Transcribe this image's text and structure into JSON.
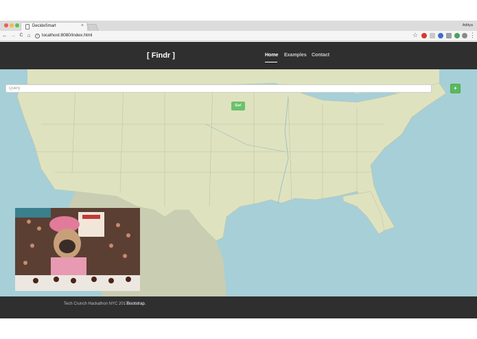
{
  "browser": {
    "tab_title": "DecideSmart",
    "tab_close": "×",
    "url": "localhost:8080/index.html",
    "user_name": "Aditya",
    "back": "←",
    "forward": "→",
    "reload": "C",
    "home": "⌂",
    "info": "i",
    "star": "☆",
    "menu": "⋮"
  },
  "header": {
    "brand": "[ Findr ]",
    "nav": [
      {
        "label": "Home",
        "active": true
      },
      {
        "label": "Examples",
        "active": false
      },
      {
        "label": "Contact",
        "active": false
      }
    ]
  },
  "search": {
    "placeholder": "Query",
    "value": "",
    "add_label": "+",
    "go_label": "Go!"
  },
  "map": {
    "water_color": "#a6cfd8",
    "land_color": "#dfe2bf",
    "gulf_land_color": "#c9cdb1"
  },
  "footer": {
    "text": "Tech Crunch Hackathon NYC 2017",
    "link": "Bootstrap",
    "suffix": "."
  },
  "colors": {
    "header_bg": "#2f2f2f",
    "accent_green": "#5cb85c"
  }
}
